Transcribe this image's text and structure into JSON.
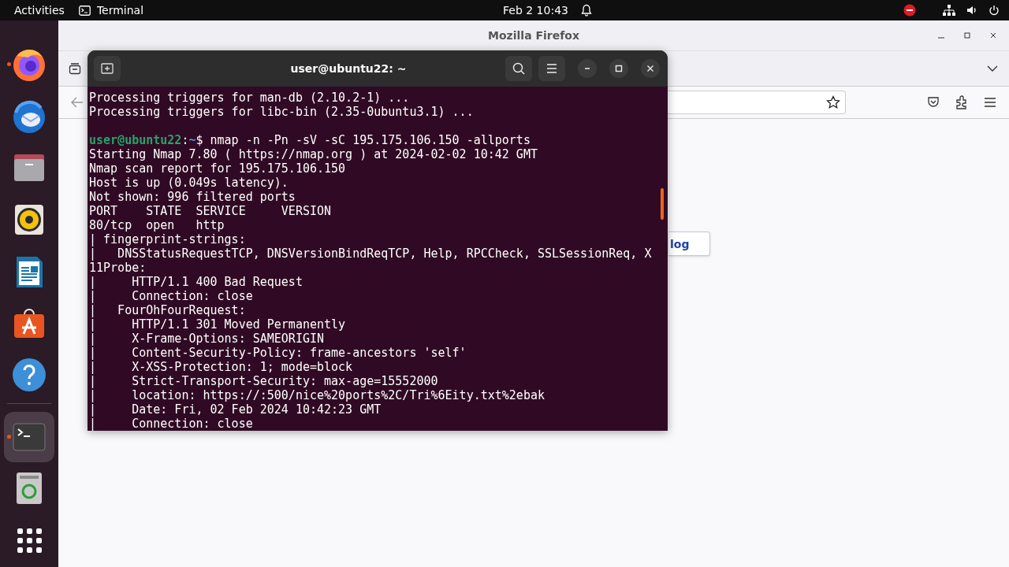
{
  "top_bar": {
    "activities": "Activities",
    "app": "Terminal",
    "clock": "Feb 2  10:43"
  },
  "dock": {
    "items": [
      {
        "kind": "browser",
        "running": true,
        "selected": false
      },
      {
        "kind": "mail",
        "running": false,
        "selected": false
      },
      {
        "kind": "files",
        "running": false,
        "selected": false
      },
      {
        "kind": "music",
        "running": false,
        "selected": false
      },
      {
        "kind": "writer",
        "running": false,
        "selected": false
      },
      {
        "kind": "store",
        "running": false,
        "selected": false
      },
      {
        "kind": "help",
        "running": false,
        "selected": false
      },
      {
        "kind": "terminal",
        "running": true,
        "selected": true
      },
      {
        "kind": "trash",
        "running": false,
        "selected": false
      },
      {
        "kind": "apps",
        "running": false,
        "selected": false
      }
    ]
  },
  "browser": {
    "title": "Mozilla Firefox",
    "page_button": "log"
  },
  "terminal": {
    "title": "user@ubuntu22: ~",
    "lines": [
      {
        "kind": "text",
        "text": "Processing triggers for man-db (2.10.2-1) ..."
      },
      {
        "kind": "text",
        "text": "Processing triggers for libc-bin (2.35-0ubuntu3.1) ..."
      },
      {
        "kind": "blank"
      },
      {
        "kind": "prompt",
        "user": "user@ubuntu22",
        "sep": ":",
        "path": "~",
        "command": "$ nmap -n -Pn -sV -sC 195.175.106.150 -allports"
      },
      {
        "kind": "text",
        "text": "Starting Nmap 7.80 ( https://nmap.org ) at 2024-02-02 10:42 GMT"
      },
      {
        "kind": "text",
        "text": "Nmap scan report for 195.175.106.150"
      },
      {
        "kind": "text",
        "text": "Host is up (0.049s latency)."
      },
      {
        "kind": "text",
        "text": "Not shown: 996 filtered ports"
      },
      {
        "kind": "text",
        "text": "PORT    STATE  SERVICE     VERSION"
      },
      {
        "kind": "text",
        "text": "80/tcp  open   http"
      },
      {
        "kind": "text",
        "text": "| fingerprint-strings:"
      },
      {
        "kind": "text",
        "text": "|   DNSStatusRequestTCP, DNSVersionBindReqTCP, Help, RPCCheck, SSLSessionReq, X"
      },
      {
        "kind": "text",
        "text": "11Probe:"
      },
      {
        "kind": "text",
        "text": "|     HTTP/1.1 400 Bad Request"
      },
      {
        "kind": "text",
        "text": "|     Connection: close"
      },
      {
        "kind": "text",
        "text": "|   FourOhFourRequest:"
      },
      {
        "kind": "text",
        "text": "|     HTTP/1.1 301 Moved Permanently"
      },
      {
        "kind": "text",
        "text": "|     X-Frame-Options: SAMEORIGIN"
      },
      {
        "kind": "text",
        "text": "|     Content-Security-Policy: frame-ancestors 'self'"
      },
      {
        "kind": "text",
        "text": "|     X-XSS-Protection: 1; mode=block"
      },
      {
        "kind": "text",
        "text": "|     Strict-Transport-Security: max-age=15552000"
      },
      {
        "kind": "text",
        "text": "|     location: https://:500/nice%20ports%2C/Tri%6Eity.txt%2ebak"
      },
      {
        "kind": "text",
        "text": "|     Date: Fri, 02 Feb 2024 10:42:23 GMT"
      },
      {
        "kind": "text",
        "text": "|     Connection: close"
      }
    ]
  }
}
